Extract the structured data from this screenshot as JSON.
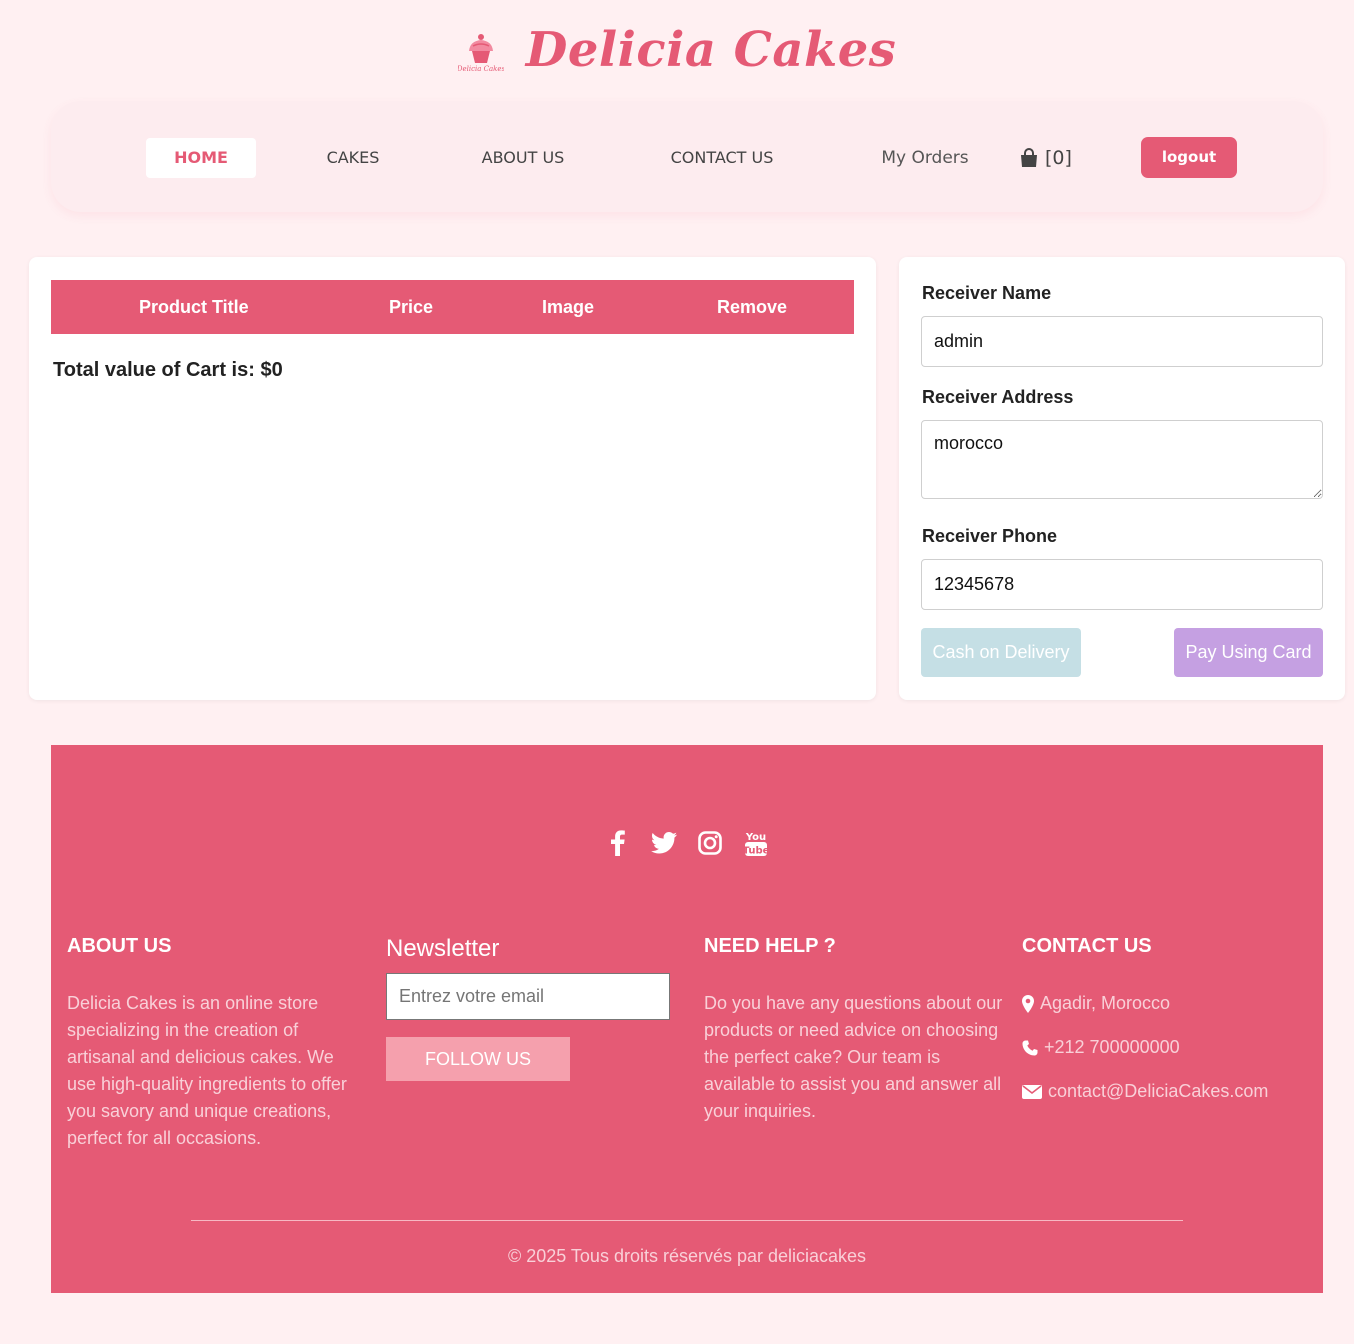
{
  "brand": {
    "title": "Delicia Cakes",
    "logo_text": "Delicia Cakes",
    "accent": "#e55a75"
  },
  "nav": {
    "items": [
      {
        "label": "HOME",
        "active": true
      },
      {
        "label": "CAKES"
      },
      {
        "label": "ABOUT US"
      },
      {
        "label": "CONTACT US"
      }
    ],
    "orders_label": "My Orders",
    "cart_count": "[0]",
    "logout_label": "logout"
  },
  "cart": {
    "columns": [
      "Product Title",
      "Price",
      "Image",
      "Remove"
    ],
    "total_text": "Total value of Cart is: $0"
  },
  "receiver": {
    "name_label": "Receiver Name",
    "name_value": "admin",
    "address_label": "Receiver Address",
    "address_value": "morocco",
    "phone_label": "Receiver Phone",
    "phone_value": "12345678",
    "cod_label": "Cash on Delivery",
    "card_label": "Pay Using Card"
  },
  "footer": {
    "social": [
      "facebook-icon",
      "twitter-icon",
      "instagram-icon",
      "youtube-icon"
    ],
    "about": {
      "title": "ABOUT US",
      "text": "Delicia Cakes is an online store specializing in the creation of artisanal and delicious cakes. We use high-quality ingredients to offer you savory and unique creations, perfect for all occasions."
    },
    "newsletter": {
      "title": "Newsletter",
      "placeholder": "Entrez votre email",
      "button": "FOLLOW US"
    },
    "help": {
      "title": "NEED HELP ?",
      "text": "Do you have any questions about our products or need advice on choosing the perfect cake? Our team is available to assist you and answer all your inquiries."
    },
    "contact": {
      "title": "CONTACT US",
      "location": "Agadir, Morocco",
      "phone": "+212 700000000",
      "email": "contact@DeliciaCakes.com"
    },
    "copyright": "© 2025 Tous droits réservés par deliciacakes"
  }
}
